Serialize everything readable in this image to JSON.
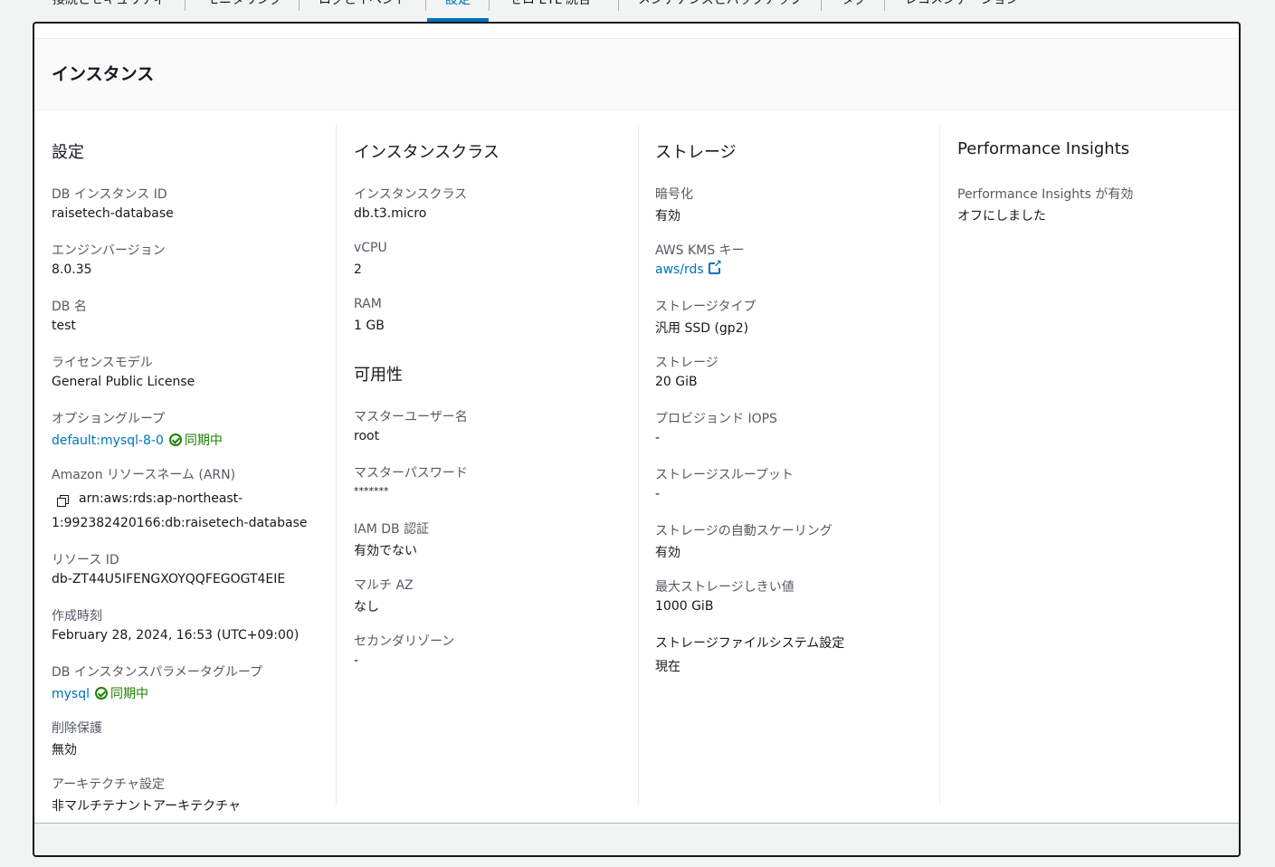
{
  "tabs": [
    {
      "label": "接続とセキュリティ"
    },
    {
      "label": "モニタリング"
    },
    {
      "label": "ログとイベント"
    },
    {
      "label": "設定"
    },
    {
      "label": "ゼロ ETL 統合"
    },
    {
      "label": "メンテナンスとバックアップ"
    },
    {
      "label": "タグ"
    },
    {
      "label": "レコメンデーション"
    }
  ],
  "panel": {
    "title": "インスタンス"
  },
  "config": {
    "heading": "設定",
    "db_instance_id_label": "DB インスタンス ID",
    "db_instance_id": "raisetech-database",
    "engine_version_label": "エンジンバージョン",
    "engine_version": "8.0.35",
    "db_name_label": "DB 名",
    "db_name": "test",
    "license_model_label": "ライセンスモデル",
    "license_model": "General Public License",
    "option_group_label": "オプショングループ",
    "option_group": "default:mysql-8-0",
    "option_group_status": "同期中",
    "arn_label": "Amazon リソースネーム (ARN)",
    "arn_line1": "arn:aws:rds:ap-northeast-",
    "arn_line2": "1:992382420166:db:raisetech-database",
    "resource_id_label": "リソース ID",
    "resource_id": "db-ZT44U5IFENGXOYQQFEGOGT4EIE",
    "created_label": "作成時刻",
    "created": "February 28, 2024, 16:53 (UTC+09:00)",
    "param_group_label": "DB インスタンスパラメータグループ",
    "param_group": "mysql",
    "param_group_status": "同期中",
    "deletion_protection_label": "削除保護",
    "deletion_protection": "無効",
    "architecture_label": "アーキテクチャ設定",
    "architecture": "非マルチテナントアーキテクチャ"
  },
  "instance_class": {
    "heading": "インスタンスクラス",
    "class_label": "インスタンスクラス",
    "class": "db.t3.micro",
    "vcpu_label": "vCPU",
    "vcpu": "2",
    "ram_label": "RAM",
    "ram": "1 GB"
  },
  "availability": {
    "heading": "可用性",
    "master_user_label": "マスターユーザー名",
    "master_user": "root",
    "master_password_label": "マスターパスワード",
    "master_password": "*******",
    "iam_auth_label": "IAM DB 認証",
    "iam_auth": "有効でない",
    "multi_az_label": "マルチ AZ",
    "multi_az": "なし",
    "secondary_zone_label": "セカンダリゾーン",
    "secondary_zone": "-"
  },
  "storage": {
    "heading": "ストレージ",
    "encryption_label": "暗号化",
    "encryption": "有効",
    "kms_key_label": "AWS KMS キー",
    "kms_key": "aws/rds",
    "storage_type_label": "ストレージタイプ",
    "storage_type": "汎用 SSD (gp2)",
    "storage_label": "ストレージ",
    "storage": "20 GiB",
    "iops_label": "プロビジョンド IOPS",
    "iops": "-",
    "throughput_label": "ストレージスループット",
    "throughput": "-",
    "autoscaling_label": "ストレージの自動スケーリング",
    "autoscaling": "有効",
    "max_threshold_label": "最大ストレージしきい値",
    "max_threshold": "1000 GiB",
    "fs_config_label": "ストレージファイルシステム設定",
    "fs_config": "現在"
  },
  "performance": {
    "heading": "Performance Insights",
    "status_label": "Performance Insights が有効",
    "status": "オフにしました"
  }
}
